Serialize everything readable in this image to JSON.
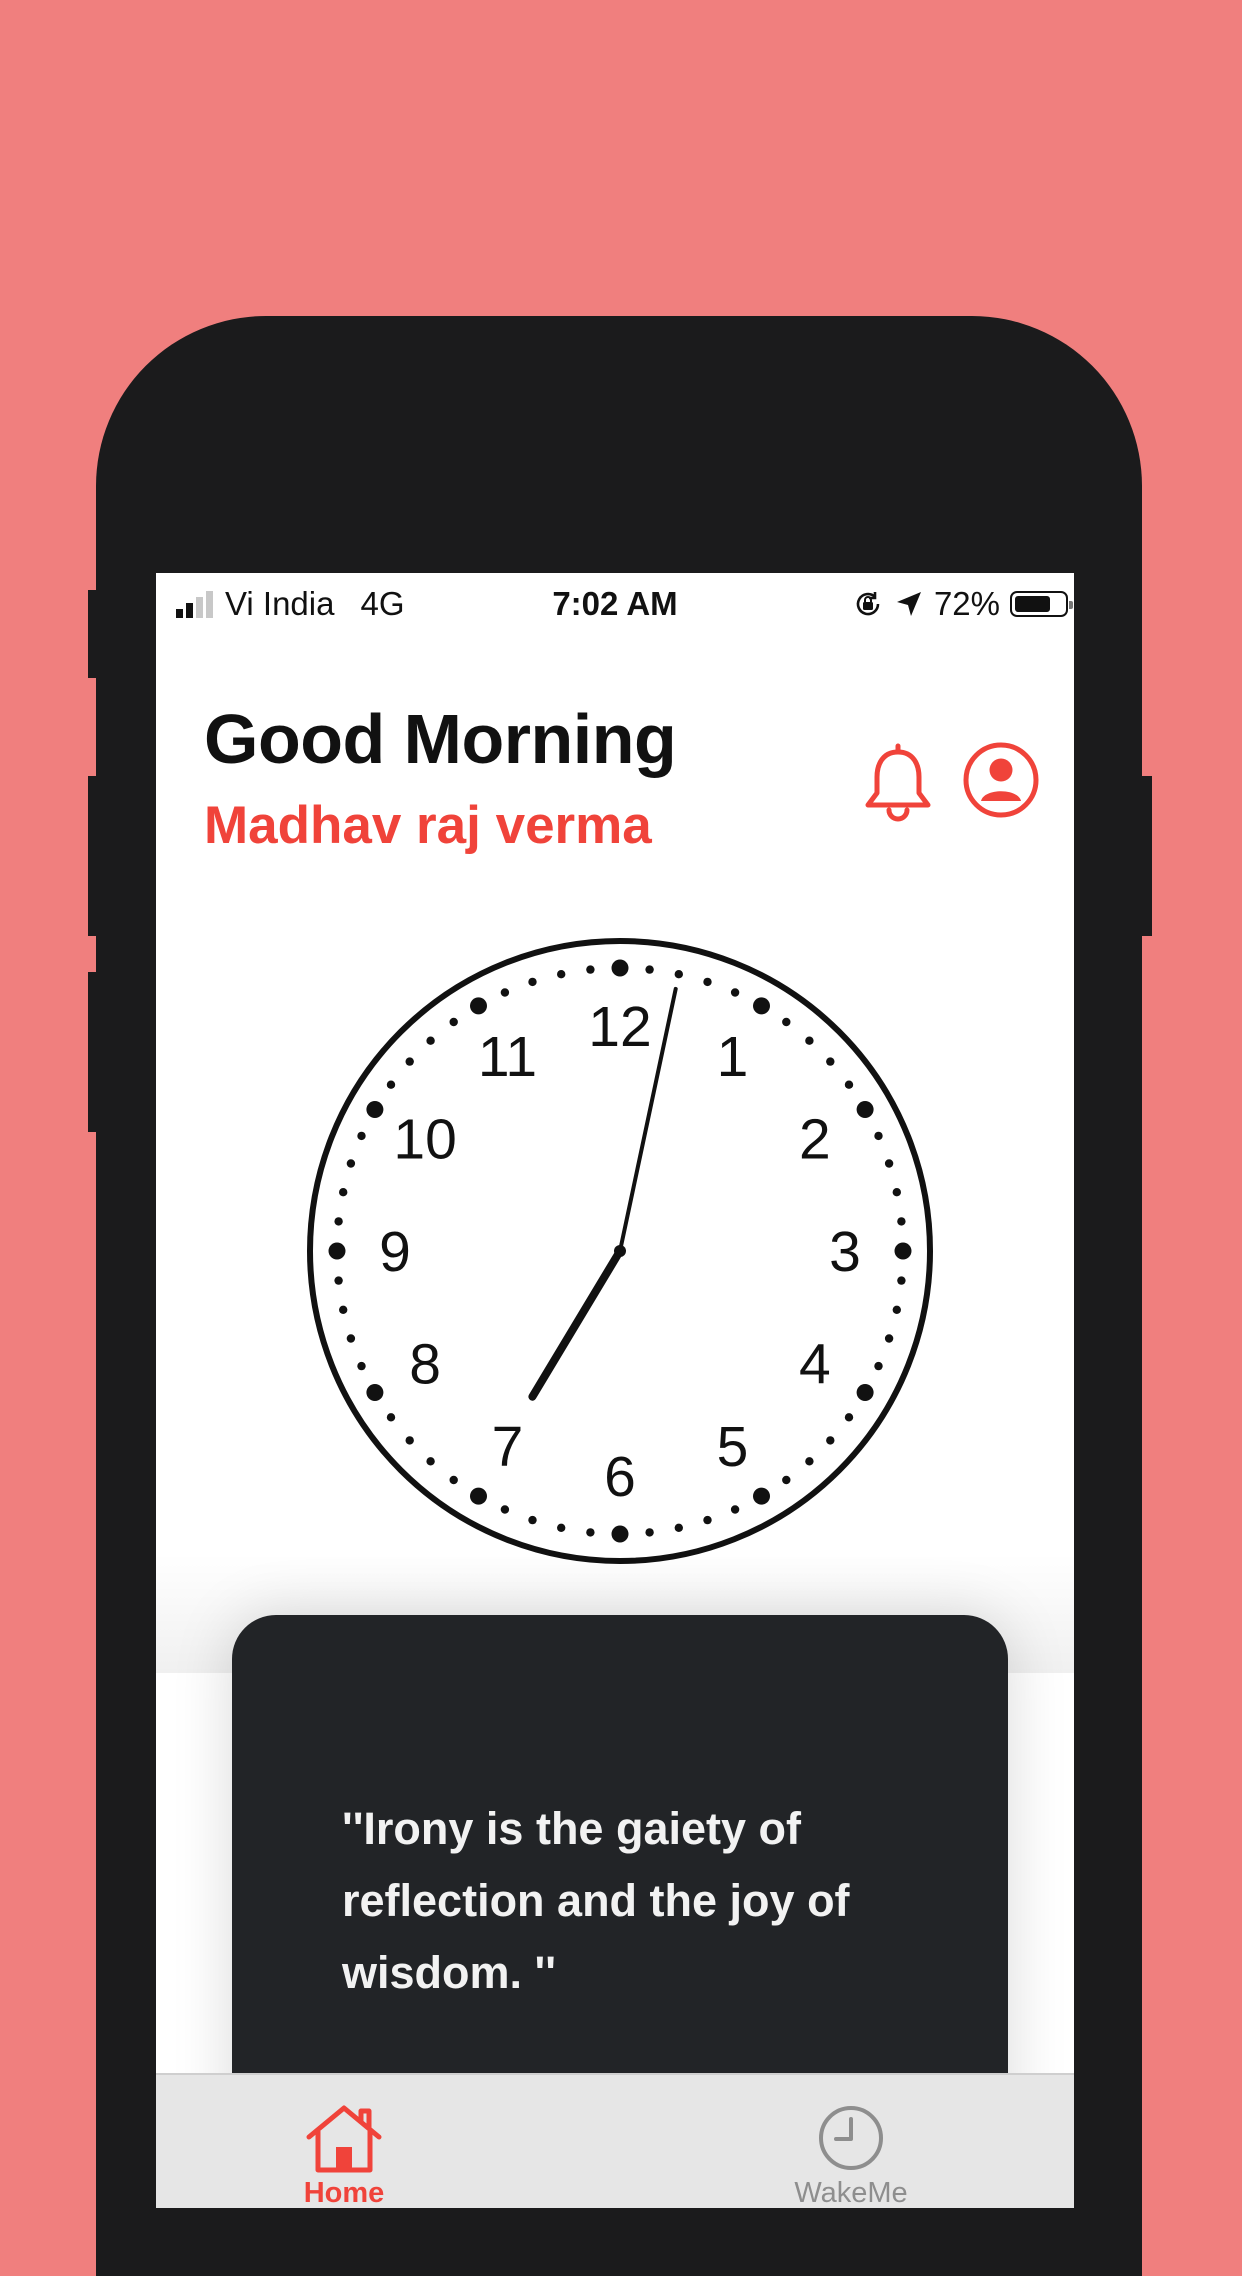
{
  "status_bar": {
    "carrier": "Vi India",
    "network": "4G",
    "time": "7:02 AM",
    "battery": "72%",
    "battery_level": 0.72,
    "signal_bars_active": 2,
    "signal_bars_total": 4
  },
  "header": {
    "greeting": "Good Morning",
    "user_name": "Madhav raj verma",
    "notifications_icon": "bell-icon",
    "profile_icon": "user-circle-icon"
  },
  "clock": {
    "hour": 7,
    "minute": 2,
    "numbers": [
      "12",
      "1",
      "2",
      "3",
      "4",
      "5",
      "6",
      "7",
      "8",
      "9",
      "10",
      "11"
    ]
  },
  "quote": {
    "text": " ''Irony is the gaiety of reflection and the joy of wisdom. ''"
  },
  "tab_bar": {
    "home_label": "Home",
    "home_icon": "home-icon",
    "wakeme_label": "WakeMe",
    "wakeme_icon": "clock-icon"
  },
  "colors": {
    "background": "#F07F7E",
    "accent": "#F0433A",
    "card": "#222427",
    "tab_inactive": "#8E8E8E"
  }
}
